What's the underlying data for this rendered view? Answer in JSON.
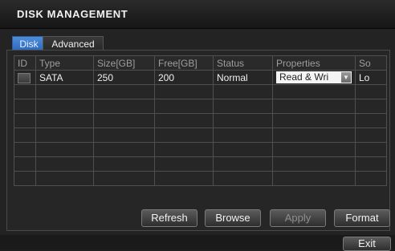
{
  "window": {
    "title": "DISK MANAGEMENT"
  },
  "tabs": [
    {
      "label": "Disk",
      "active": true
    },
    {
      "label": "Advanced",
      "active": false
    }
  ],
  "table": {
    "columns": [
      "ID",
      "Type",
      "Size[GB]",
      "Free[GB]",
      "Status",
      "Properties",
      "So"
    ],
    "rows": [
      {
        "type": "SATA",
        "size": "250",
        "free": "200",
        "status": "Normal",
        "properties": "Read & Wri",
        "source": "Lo"
      }
    ]
  },
  "buttons": {
    "refresh": "Refresh",
    "browse": "Browse",
    "apply": "Apply",
    "format": "Format",
    "exit": "Exit"
  },
  "colors": {
    "accent": "#2a63b8",
    "background": "#232323"
  }
}
